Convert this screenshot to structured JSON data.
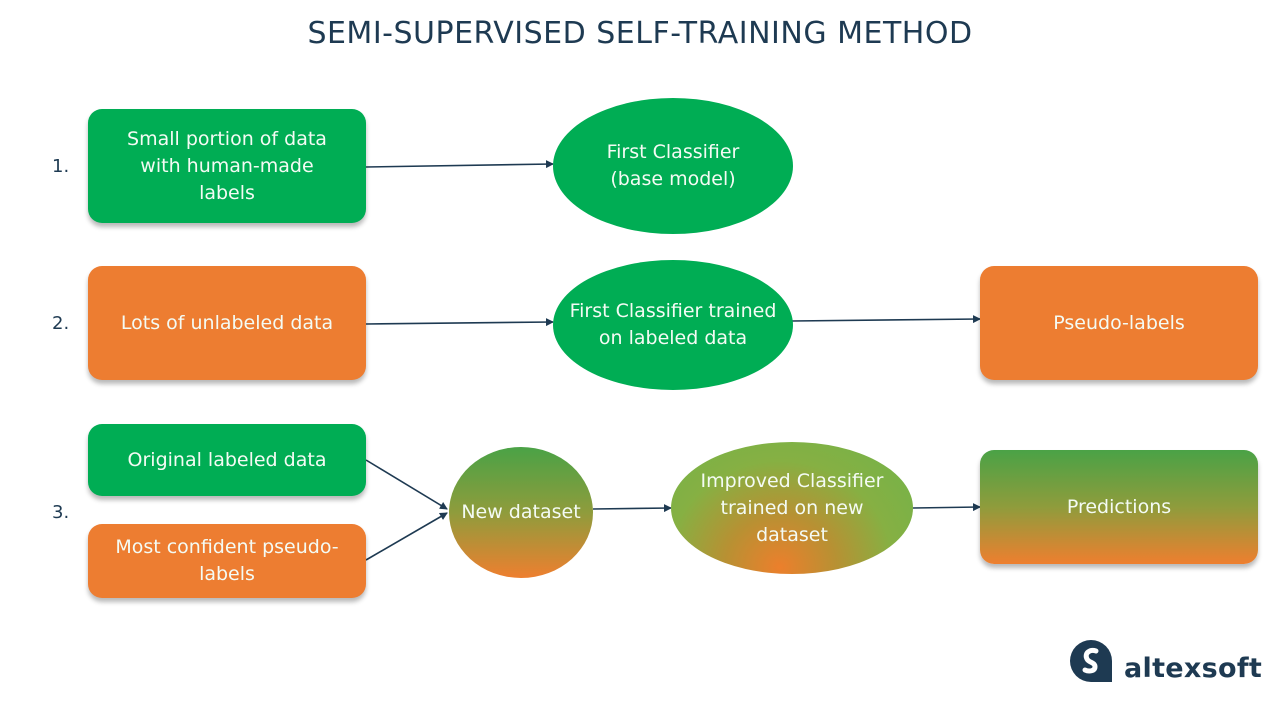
{
  "title": "SEMI-SUPERVISED SELF-TRAINING METHOD",
  "steps": [
    {
      "number": "1.",
      "nodes": [
        {
          "id": "small-labeled",
          "text": "Small portion of data with human-made labels",
          "shape": "box",
          "color": "#00ad54"
        },
        {
          "id": "first-classifier",
          "text": "First Classifier (base model)",
          "shape": "oval",
          "color": "#00ad54"
        }
      ]
    },
    {
      "number": "2.",
      "nodes": [
        {
          "id": "unlabeled",
          "text": "Lots of unlabeled data",
          "shape": "box",
          "color": "#ed7d31"
        },
        {
          "id": "trained-classifier",
          "text": "First Classifier trained on labeled data",
          "shape": "oval",
          "color": "#00ad54"
        },
        {
          "id": "pseudo-labels",
          "text": "Pseudo-labels",
          "shape": "box",
          "color": "#ed7d31"
        }
      ]
    },
    {
      "number": "3.",
      "nodes": [
        {
          "id": "original-labeled",
          "text": "Original labeled data",
          "shape": "box",
          "color": "#00ad54"
        },
        {
          "id": "confident-pseudo",
          "text": "Most confident pseudo-labels",
          "shape": "box",
          "color": "#ed7d31"
        },
        {
          "id": "new-dataset",
          "text": "New dataset",
          "shape": "circle",
          "color": "green-orange gradient"
        },
        {
          "id": "improved-classifier",
          "text": "Improved Classifier trained on new dataset",
          "shape": "oval",
          "color": "green-orange gradient"
        },
        {
          "id": "predictions",
          "text": "Predictions",
          "shape": "box",
          "color": "green-orange gradient"
        }
      ]
    }
  ],
  "edges": [
    {
      "from": "small-labeled",
      "to": "first-classifier"
    },
    {
      "from": "unlabeled",
      "to": "trained-classifier"
    },
    {
      "from": "trained-classifier",
      "to": "pseudo-labels"
    },
    {
      "from": "original-labeled",
      "to": "new-dataset"
    },
    {
      "from": "confident-pseudo",
      "to": "new-dataset"
    },
    {
      "from": "new-dataset",
      "to": "improved-classifier"
    },
    {
      "from": "improved-classifier",
      "to": "predictions"
    }
  ],
  "colors": {
    "green": "#00ad54",
    "orange": "#ed7d31",
    "text_dark": "#1e3a52",
    "arrow": "#1e3a52"
  },
  "logo": {
    "text": "altexsoft",
    "icon": "altexsoft-logo-icon"
  }
}
